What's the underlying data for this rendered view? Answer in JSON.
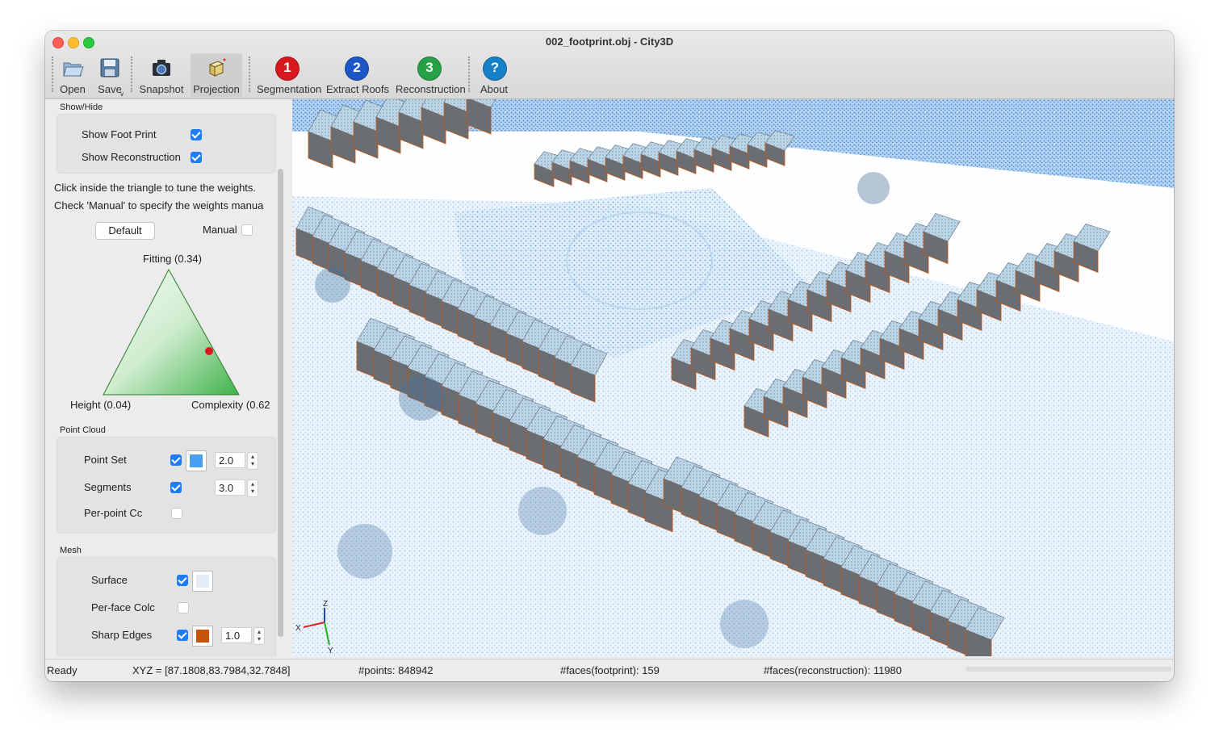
{
  "window": {
    "title": "002_footprint.obj - City3D"
  },
  "toolbar": {
    "open": "Open",
    "save": "Save",
    "snapshot": "Snapshot",
    "projection": "Projection",
    "segmentation": "Segmentation",
    "extract_roofs": "Extract Roofs",
    "reconstruction": "Reconstruction",
    "about": "About",
    "step1": "1",
    "step2": "2",
    "step3": "3",
    "help": "?"
  },
  "show_hide": {
    "title": "Show/Hide",
    "show_footprint": "Show Foot Print",
    "show_footprint_checked": true,
    "show_reconstruction": "Show Reconstruction",
    "show_reconstruction_checked": true
  },
  "weights": {
    "hint1": "Click inside the triangle to tune the weights.",
    "hint2": "Check 'Manual' to specify the weights manua",
    "default_button": "Default",
    "manual": "Manual",
    "manual_checked": false,
    "fitting": "Fitting (0.34)",
    "height": "Height (0.04)",
    "complexity": "Complexity (0.62",
    "values": {
      "fitting": 0.34,
      "height": 0.04,
      "complexity": 0.62
    }
  },
  "point_cloud": {
    "title": "Point Cloud",
    "point_set": "Point Set",
    "point_set_checked": true,
    "point_set_color": "#4a9ef0",
    "point_size": "2.0",
    "segments": "Segments",
    "segments_checked": true,
    "segments_size": "3.0",
    "per_point": "Per-point Cc",
    "per_point_checked": false
  },
  "mesh": {
    "title": "Mesh",
    "surface": "Surface",
    "surface_checked": true,
    "surface_color": "#e4ecf8",
    "per_face": "Per-face Colc",
    "per_face_checked": false,
    "sharp_edges": "Sharp Edges",
    "sharp_edges_checked": true,
    "sharp_edges_color": "#c8540c",
    "sharp_edges_size": "1.0"
  },
  "axes": {
    "x": "X",
    "y": "Y",
    "z": "Z"
  },
  "status": {
    "state": "Ready",
    "xyz": "XYZ = [87.1808,83.7984,32.7848]",
    "points": "#points: 848942",
    "faces_footprint": "#faces(footprint): 159",
    "faces_reconstruction": "#faces(reconstruction): 11980"
  },
  "colors": {
    "accent": "#1e7cf5",
    "point_blue": "#3f8fd8",
    "edge_orange": "#c8540c",
    "building_gray": "#6a6e73"
  }
}
